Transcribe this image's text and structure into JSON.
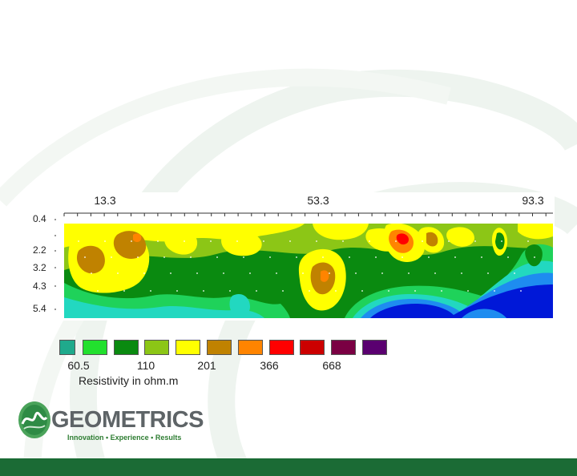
{
  "chart_data": {
    "type": "heatmap",
    "x_tick_labels": [
      "13.3",
      "53.3",
      "93.3"
    ],
    "y_tick_labels": [
      "0.4",
      "2.2",
      "3.2",
      "4.3",
      "5.4"
    ],
    "legend": {
      "labels": [
        "60.5",
        "110",
        "201",
        "366",
        "668"
      ],
      "title": "Resistivity in ohm.m",
      "colors": [
        "#1faa8c",
        "#22e02e",
        "#0a8a10",
        "#8cc616",
        "#ffff00",
        "#c08200",
        "#ff8400",
        "#ff0000",
        "#cc0000",
        "#7a0043",
        "#5a0070"
      ]
    },
    "grid": false
  },
  "brand": {
    "name": "GEOMETRICS",
    "tagline": "Innovation • Experience • Results",
    "accent": "#1b6b35"
  }
}
